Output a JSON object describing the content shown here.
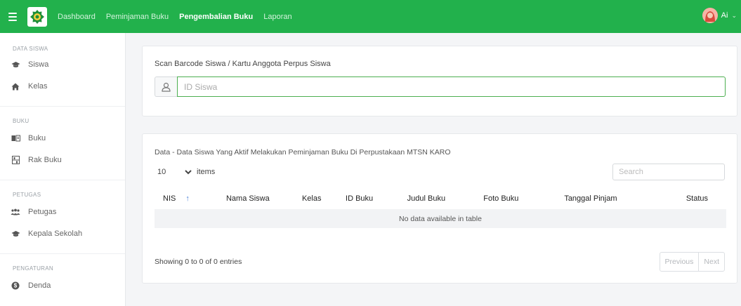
{
  "navbar": {
    "links": [
      "Dashboard",
      "Peminjaman Buku",
      "Pengembalian Buku",
      "Laporan"
    ],
    "active_index": 2,
    "user_name": "Ai",
    "accent_color": "#22b14c"
  },
  "sidebar": {
    "sections": [
      {
        "heading": "DATA SISWA",
        "items": [
          {
            "label": "Siswa",
            "icon": "graduation-cap-icon"
          },
          {
            "label": "Kelas",
            "icon": "home-icon"
          }
        ]
      },
      {
        "heading": "BUKU",
        "items": [
          {
            "label": "Buku",
            "icon": "book-open-icon"
          },
          {
            "label": "Rak Buku",
            "icon": "shelf-icon"
          }
        ]
      },
      {
        "heading": "PETUGAS",
        "items": [
          {
            "label": "Petugas",
            "icon": "users-icon"
          },
          {
            "label": "Kepala Sekolah",
            "icon": "graduation-cap-icon"
          }
        ]
      },
      {
        "heading": "PENGATURAN",
        "items": [
          {
            "label": "Denda",
            "icon": "money-icon"
          }
        ]
      }
    ]
  },
  "scan": {
    "label": "Scan Barcode Siswa / Kartu Anggota Perpus Siswa",
    "placeholder": "ID Siswa",
    "value": ""
  },
  "table_card": {
    "title": "Data - Data Siswa Yang Aktif Melakukan Peminjaman Buku Di Perpustakaan MTSN KARO",
    "page_length": "10",
    "items_label": "items",
    "search_placeholder": "Search",
    "columns": [
      "NIS",
      "Nama Siswa",
      "Kelas",
      "ID Buku",
      "Judul Buku",
      "Foto Buku",
      "Tanggal Pinjam",
      "Status"
    ],
    "sort_indicator": "↑",
    "empty_text": "No data available in table",
    "info": "Showing 0 to 0 of 0 entries",
    "prev_label": "Previous",
    "next_label": "Next"
  }
}
